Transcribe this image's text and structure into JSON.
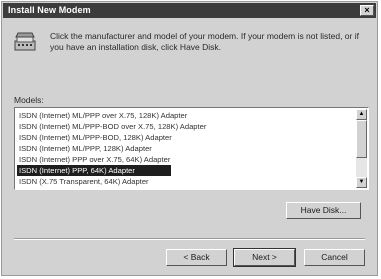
{
  "window": {
    "title": "Install New Modem",
    "close_glyph": "×"
  },
  "instructions": {
    "text": "Click the manufacturer and model of your modem. If your modem is not listed, or if you have an installation disk, click Have Disk.",
    "icon": "modem-icon"
  },
  "models": {
    "label": "Models:",
    "items": [
      "ISDN (Internet) ML/PPP over X.75, 128K) Adapter",
      "ISDN (Internet) ML/PPP-BOD over X.75, 128K) Adapter",
      "ISDN (Internet) ML/PPP-BOD, 128K) Adapter",
      "ISDN (Internet) ML/PPP, 128K) Adapter",
      "ISDN (Internet) PPP over X.75, 64K) Adapter",
      "ISDN (Internet) PPP, 64K) Adapter",
      "ISDN (X.75 Transparent, 64K) Adapter"
    ],
    "selected_index": 5
  },
  "buttons": {
    "have_disk": "Have Disk...",
    "back": "< Back",
    "next": "Next >",
    "cancel": "Cancel"
  }
}
